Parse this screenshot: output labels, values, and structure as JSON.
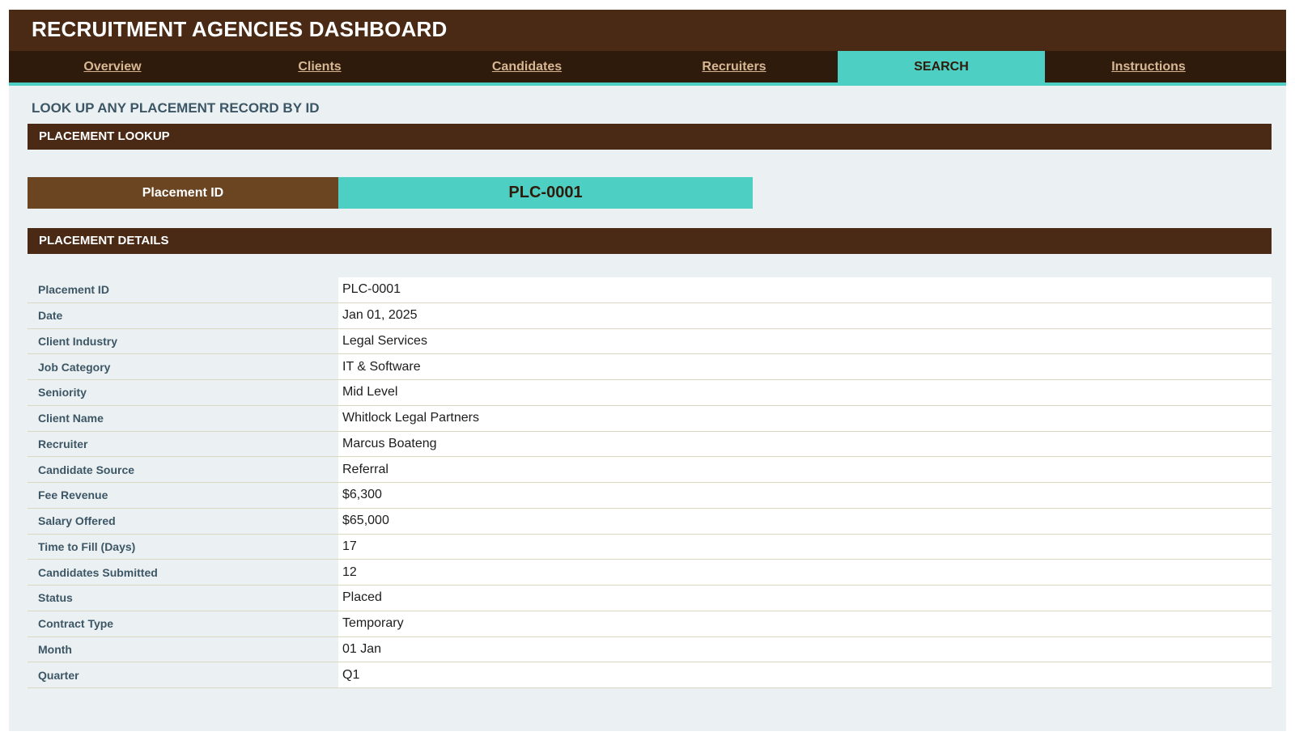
{
  "header": {
    "title": "RECRUITMENT AGENCIES DASHBOARD"
  },
  "nav": {
    "tabs": [
      {
        "label": "Overview",
        "active": false
      },
      {
        "label": "Clients",
        "active": false
      },
      {
        "label": "Candidates",
        "active": false
      },
      {
        "label": "Recruiters",
        "active": false
      },
      {
        "label": "SEARCH",
        "active": true
      },
      {
        "label": "Instructions",
        "active": false
      }
    ]
  },
  "page": {
    "subtitle": "LOOK UP ANY PLACEMENT RECORD BY ID"
  },
  "lookup": {
    "header": "PLACEMENT LOOKUP",
    "label": "Placement ID",
    "value": "PLC-0001"
  },
  "details": {
    "header": "PLACEMENT DETAILS",
    "rows": [
      {
        "label": "Placement ID",
        "value": "PLC-0001"
      },
      {
        "label": "Date",
        "value": "Jan 01, 2025"
      },
      {
        "label": "Client Industry",
        "value": "Legal Services"
      },
      {
        "label": "Job Category",
        "value": "IT & Software"
      },
      {
        "label": "Seniority",
        "value": "Mid Level"
      },
      {
        "label": "Client Name",
        "value": "Whitlock Legal Partners"
      },
      {
        "label": "Recruiter",
        "value": "Marcus Boateng"
      },
      {
        "label": "Candidate Source",
        "value": "Referral"
      },
      {
        "label": "Fee Revenue",
        "value": "$6,300"
      },
      {
        "label": "Salary Offered",
        "value": "$65,000"
      },
      {
        "label": "Time to Fill (Days)",
        "value": "17"
      },
      {
        "label": "Candidates Submitted",
        "value": "12"
      },
      {
        "label": "Status",
        "value": "Placed"
      },
      {
        "label": "Contract Type",
        "value": "Temporary"
      },
      {
        "label": "Month",
        "value": "01 Jan"
      },
      {
        "label": "Quarter",
        "value": "Q1"
      }
    ]
  },
  "colors": {
    "header_brown": "#4a2a15",
    "nav_dark": "#2f1b0c",
    "accent_teal": "#4ecfc3",
    "label_brown": "#6b4522",
    "sheet_bg": "#ebf1f2"
  }
}
